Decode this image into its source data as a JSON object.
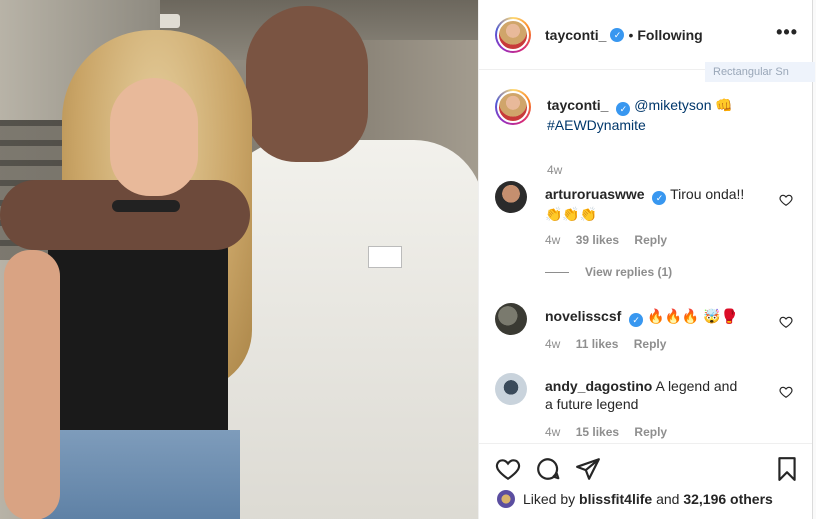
{
  "post": {
    "author": "tayconti_",
    "follow_status": "Following",
    "separator": "•",
    "more_icon": "more-horizontal-icon",
    "overlay_tag": "Rectangular Sn"
  },
  "caption": {
    "author": "tayconti_",
    "mention": "@mikety son",
    "mention_text": "@miketyson",
    "emoji": "👊",
    "hashtag": "#AEWDynamite",
    "time": "4w"
  },
  "comments": [
    {
      "user": "arturoruaswwe",
      "verified": true,
      "text": "Tirou onda!!",
      "emoji": "👏👏👏",
      "time": "4w",
      "likes": "39 likes",
      "reply": "Reply",
      "view_replies": "View replies (1)"
    },
    {
      "user": "novelisscsf",
      "verified": true,
      "text": "🔥🔥🔥 🤯🥊",
      "time": "4w",
      "likes": "11 likes",
      "reply": "Reply"
    },
    {
      "user": "andy_dagostino",
      "verified": false,
      "text": "A legend and a future legend",
      "time": "4w",
      "likes": "15 likes",
      "reply": "Reply"
    }
  ],
  "actions": {
    "like_icon": "heart-icon",
    "comment_icon": "comment-icon",
    "share_icon": "send-icon",
    "save_icon": "bookmark-icon"
  },
  "likes_summary": {
    "prefix": "Liked by",
    "user": "blissfit4life",
    "and": "and",
    "others": "32,196 others"
  },
  "colors": {
    "verified": "#3897f0",
    "link": "#00376b",
    "muted": "#8e8e8e"
  }
}
